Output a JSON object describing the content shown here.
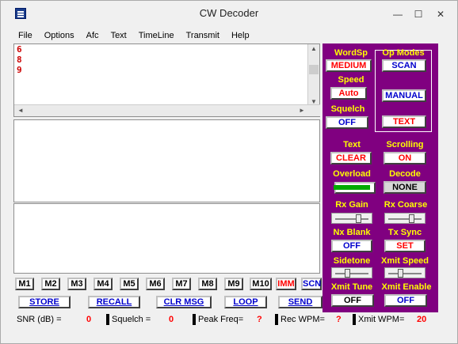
{
  "window": {
    "title": "CW Decoder",
    "min": "—",
    "max": "☐",
    "close": "✕"
  },
  "menu": [
    "File",
    "Options",
    "Afc",
    "Text",
    "TimeLine",
    "Transmit",
    "Help"
  ],
  "decode_lines": [
    "6",
    "8",
    "9"
  ],
  "panel": {
    "wordsp_label": "WordSp",
    "wordsp_value": "MEDIUM",
    "opmodes_label": "Op Modes",
    "scan": "SCAN",
    "manual": "MANUAL",
    "text_btn": "TEXT",
    "speed_label": "Speed",
    "speed_value": "Auto",
    "squelch_label": "Squelch",
    "squelch_value": "OFF",
    "text_label": "Text",
    "text_value": "CLEAR",
    "scrolling_label": "Scrolling",
    "scrolling_value": "ON",
    "overload_label": "Overload",
    "decode_label": "Decode",
    "decode_value": "NONE",
    "rxgain_label": "Rx Gain",
    "rxgain_level": 0.72,
    "rxcoarse_label": "Rx Coarse",
    "rxcoarse_level": 0.72,
    "nxblank_label": "Nx Blank",
    "nxblank_value": "OFF",
    "txsync_label": "Tx Sync",
    "txsync_value": "SET",
    "sidetone_label": "Sidetone",
    "sidetone_level": 0.38,
    "xmitspeed_label": "Xmit Speed",
    "xmitspeed_level": 0.38,
    "xmittune_label": "Xmit Tune",
    "xmittune_value": "OFF",
    "xmitenable_label": "Xmit Enable",
    "xmitenable_value": "OFF"
  },
  "memory_buttons": [
    "M1",
    "M2",
    "M3",
    "M4",
    "M5",
    "M6",
    "M7",
    "M8",
    "M9",
    "M10"
  ],
  "imm": "IMM",
  "scn": "SCN",
  "actions": {
    "store": "STORE",
    "recall": "RECALL",
    "clr_msg": "CLR MSG",
    "loop": "LOOP",
    "send": "SEND"
  },
  "status": {
    "snr_label": "SNR (dB) =",
    "snr_value": "0",
    "squelch_label": "Squelch  =",
    "squelch_value": "0",
    "peak_label": "Peak Freq=",
    "peak_value": "?",
    "recwpm_label": "Rec WPM=",
    "recwpm_value": "?",
    "xmitwpm_label": "Xmit WPM=",
    "xmitwpm_value": "20"
  },
  "colors": {
    "panel": "#800080",
    "label": "#ffff00",
    "red": "#ff0000",
    "blue": "#0000cc",
    "overload": "#00aa00"
  }
}
